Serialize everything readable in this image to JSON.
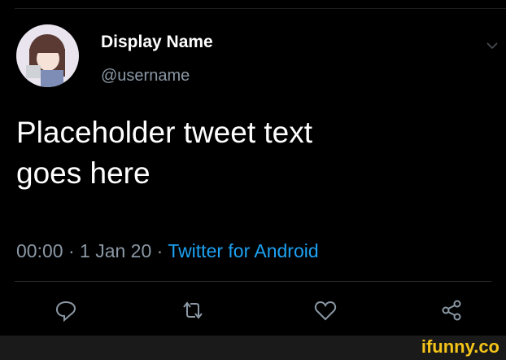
{
  "tweet": {
    "display_name": "Display Name",
    "handle": "@username",
    "body": "Placeholder tweet text\ngoes here",
    "time": "00:00",
    "sep": " · ",
    "date": "1 Jan 20",
    "client": "Twitter for Android"
  },
  "actions": [
    "reply-icon",
    "retweet-icon",
    "like-icon",
    "share-icon"
  ],
  "watermark": "ifunny.co",
  "colors": {
    "background": "#000000",
    "text": "#ffffff",
    "muted": "#8b98a5",
    "accent": "#1da1f2",
    "watermark": "#f5c418"
  }
}
